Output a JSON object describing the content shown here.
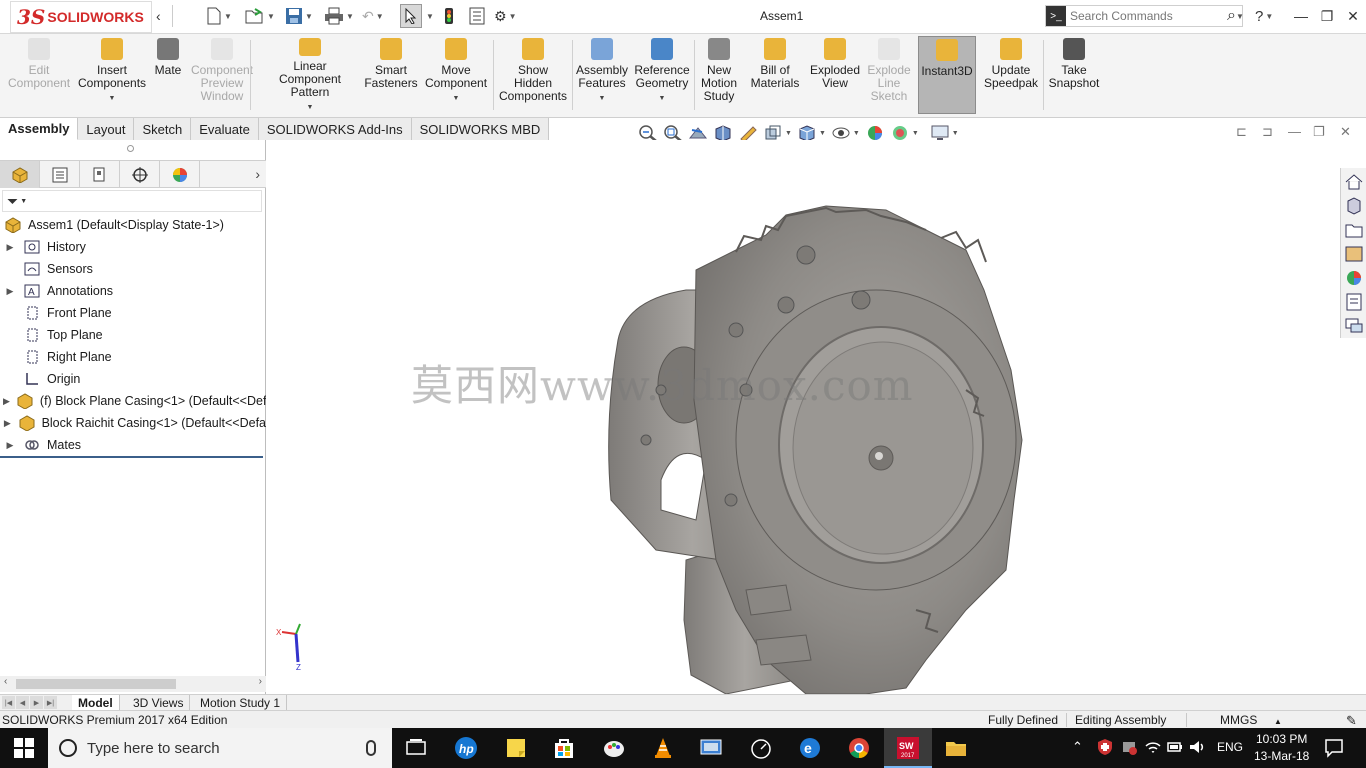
{
  "app": {
    "logo_prefix": "3S",
    "logo_name": "SOLIDWORKS",
    "document_title": "Assem1",
    "search_placeholder": "Search Commands",
    "help_glyph": "?"
  },
  "ribbon": [
    {
      "id": "edit-component",
      "lines": [
        "Edit",
        "Component"
      ],
      "enabled": false,
      "dropdown": false,
      "icon": "edit-component-icon"
    },
    {
      "id": "insert-components",
      "lines": [
        "Insert",
        "Components"
      ],
      "enabled": true,
      "dropdown": true,
      "icon": "insert-components-icon"
    },
    {
      "id": "mate",
      "lines": [
        "Mate"
      ],
      "enabled": true,
      "dropdown": false,
      "icon": "mate-paperclip-icon"
    },
    {
      "id": "component-preview-window",
      "lines": [
        "Component",
        "Preview",
        "Window"
      ],
      "enabled": false,
      "dropdown": false,
      "icon": "component-preview-icon"
    },
    {
      "id": "linear-component-pattern",
      "lines": [
        "Linear Component",
        "Pattern"
      ],
      "enabled": true,
      "dropdown": true,
      "icon": "linear-pattern-icon"
    },
    {
      "id": "smart-fasteners",
      "lines": [
        "Smart",
        "Fasteners"
      ],
      "enabled": true,
      "dropdown": false,
      "icon": "smart-fasteners-icon"
    },
    {
      "id": "move-component",
      "lines": [
        "Move",
        "Component"
      ],
      "enabled": true,
      "dropdown": true,
      "icon": "move-component-icon"
    },
    {
      "id": "show-hidden-components",
      "lines": [
        "Show",
        "Hidden",
        "Components"
      ],
      "enabled": true,
      "dropdown": false,
      "icon": "show-hidden-icon"
    },
    {
      "id": "assembly-features",
      "lines": [
        "Assembly",
        "Features"
      ],
      "enabled": true,
      "dropdown": true,
      "icon": "assembly-features-icon"
    },
    {
      "id": "reference-geometry",
      "lines": [
        "Reference",
        "Geometry"
      ],
      "enabled": true,
      "dropdown": true,
      "icon": "reference-geometry-icon"
    },
    {
      "id": "new-motion-study",
      "lines": [
        "New",
        "Motion",
        "Study"
      ],
      "enabled": true,
      "dropdown": false,
      "icon": "motion-study-icon"
    },
    {
      "id": "bill-of-materials",
      "lines": [
        "Bill of",
        "Materials"
      ],
      "enabled": true,
      "dropdown": false,
      "icon": "bill-of-materials-icon"
    },
    {
      "id": "exploded-view",
      "lines": [
        "Exploded",
        "View"
      ],
      "enabled": true,
      "dropdown": false,
      "icon": "exploded-view-icon"
    },
    {
      "id": "explode-line-sketch",
      "lines": [
        "Explode",
        "Line",
        "Sketch"
      ],
      "enabled": false,
      "dropdown": false,
      "icon": "explode-line-sketch-icon"
    },
    {
      "id": "instant3d",
      "lines": [
        "Instant3D"
      ],
      "enabled": true,
      "dropdown": false,
      "active": true,
      "icon": "instant3d-icon"
    },
    {
      "id": "update-speedpak",
      "lines": [
        "Update",
        "Speedpak"
      ],
      "enabled": true,
      "dropdown": false,
      "icon": "speedpak-icon"
    },
    {
      "id": "take-snapshot",
      "lines": [
        "Take",
        "Snapshot"
      ],
      "enabled": true,
      "dropdown": false,
      "icon": "camera-icon"
    }
  ],
  "command_tabs": [
    {
      "label": "Assembly",
      "active": true
    },
    {
      "label": "Layout",
      "active": false
    },
    {
      "label": "Sketch",
      "active": false
    },
    {
      "label": "Evaluate",
      "active": false
    },
    {
      "label": "SOLIDWORKS Add-Ins",
      "active": false
    },
    {
      "label": "SOLIDWORKS MBD",
      "active": false
    }
  ],
  "feature_tree": {
    "root": "Assem1  (Default<Display State-1>)",
    "items": [
      {
        "label": "History",
        "expandable": true,
        "icon": "history-folder-icon"
      },
      {
        "label": "Sensors",
        "expandable": false,
        "icon": "sensors-folder-icon"
      },
      {
        "label": "Annotations",
        "expandable": true,
        "icon": "annotations-icon"
      },
      {
        "label": "Front Plane",
        "expandable": false,
        "icon": "plane-icon"
      },
      {
        "label": "Top Plane",
        "expandable": false,
        "icon": "plane-icon"
      },
      {
        "label": "Right Plane",
        "expandable": false,
        "icon": "plane-icon"
      },
      {
        "label": "Origin",
        "expandable": false,
        "icon": "origin-icon"
      },
      {
        "label": "(f) Block Plane Casing<1> (Default<<Def",
        "expandable": true,
        "icon": "part-icon"
      },
      {
        "label": "Block Raichit Casing<1> (Default<<Defa",
        "expandable": true,
        "icon": "part-icon"
      },
      {
        "label": "Mates",
        "expandable": true,
        "icon": "mates-folder-icon"
      }
    ]
  },
  "watermark": "莫西网www.3dmox.com",
  "bottom_tabs": [
    {
      "label": "Model",
      "active": true
    },
    {
      "label": "3D Views",
      "active": false
    },
    {
      "label": "Motion Study 1",
      "active": false
    }
  ],
  "status": {
    "product": "SOLIDWORKS Premium 2017 x64 Edition",
    "definition": "Fully Defined",
    "mode": "Editing Assembly",
    "units": "MMGS",
    "units_arrow": "▲"
  },
  "taskbar": {
    "search_placeholder": "Type here to search",
    "language": "ENG",
    "time": "10:03 PM",
    "date": "13-Mar-18"
  },
  "colors": {
    "brand_red": "#d32a2a",
    "ribbon_bg": "#f4f4f4",
    "model_grey": "#8a8784",
    "taskbar_bg": "#101010"
  }
}
